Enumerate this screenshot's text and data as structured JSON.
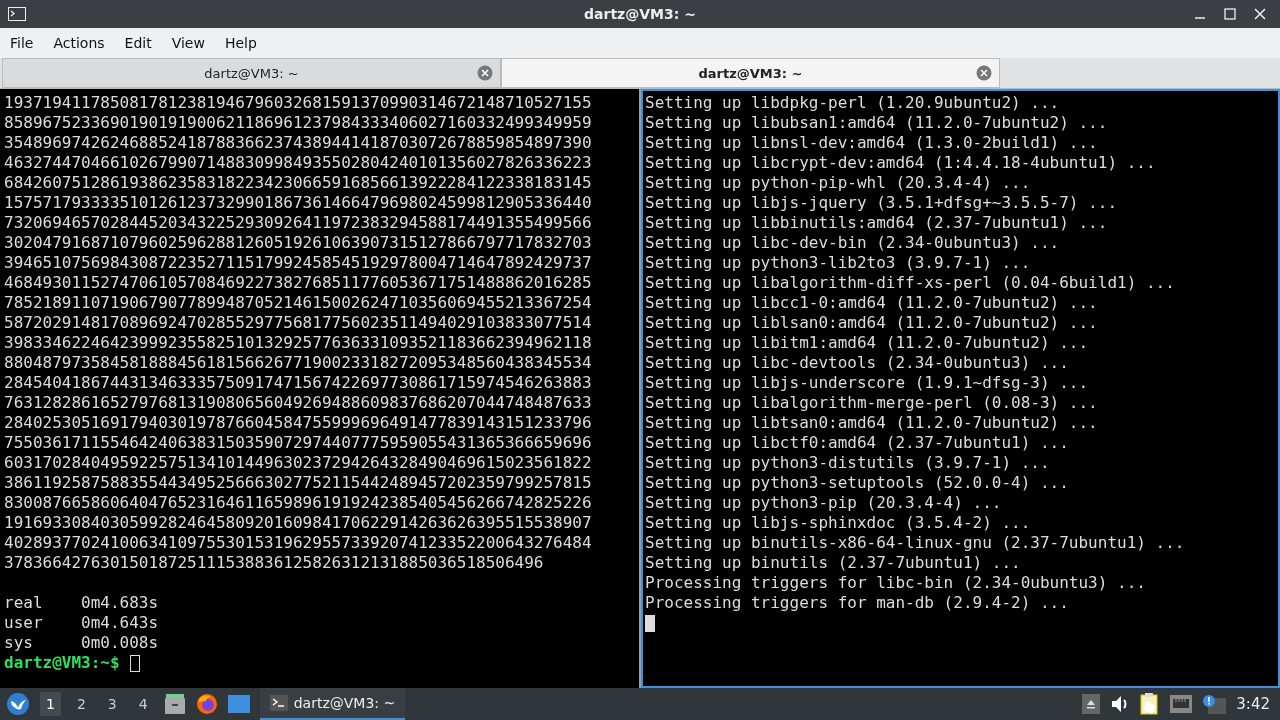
{
  "window": {
    "title": "dartz@VM3: ~"
  },
  "menu": [
    "File",
    "Actions",
    "Edit",
    "View",
    "Help"
  ],
  "tabs": [
    {
      "label": "dartz@VM3: ~",
      "selected": false
    },
    {
      "label": "dartz@VM3: ~",
      "selected": true
    }
  ],
  "panes": [
    {
      "focused": false,
      "lines": [
        {
          "kind": "output",
          "text": "1937194117850817812381946796032681591370990314672148710527155"
        },
        {
          "kind": "output",
          "text": "8589675233690190191900621186961237984333406027160332499349959"
        },
        {
          "kind": "output",
          "text": "3548969742624688524187883662374389441418703072678859854897390"
        },
        {
          "kind": "output",
          "text": "4632744704661026799071488309984935502804240101356027826336223"
        },
        {
          "kind": "output",
          "text": "6842607512861938623583182234230665916856613922284122338183145"
        },
        {
          "kind": "output",
          "text": "1575717933335101261237329901867361466479698024599812905336440"
        },
        {
          "kind": "output",
          "text": "7320694657028445203432252930926411972383294588174491355499566"
        },
        {
          "kind": "output",
          "text": "3020479168710796025962881260519261063907315127866797717832703"
        },
        {
          "kind": "output",
          "text": "3946510756984308722352711517992458545192978004714647892429737"
        },
        {
          "kind": "output",
          "text": "4684930115274706105708469227382768511776053671751488862016285"
        },
        {
          "kind": "output",
          "text": "7852189110719067907789948705214615002624710356069455213367254"
        },
        {
          "kind": "output",
          "text": "5872029148170896924702855297756817756023511494029103833077514"
        },
        {
          "kind": "output",
          "text": "3983346224642399923558251013292577636331093521183662394962118"
        },
        {
          "kind": "output",
          "text": "8804879735845818884561815662677190023318272095348560438345534"
        },
        {
          "kind": "output",
          "text": "2845404186744313463335750917471567422697730861715974546263883"
        },
        {
          "kind": "output",
          "text": "7631282861652797681319080656049269488609837686207044748487633"
        },
        {
          "kind": "output",
          "text": "2840253051691794030197876604584755999696491477839143151233796"
        },
        {
          "kind": "output",
          "text": "7550361711554642406383150359072974407775959055431365366659696"
        },
        {
          "kind": "output",
          "text": "6031702840495922575134101449630237294264328490469615023561822"
        },
        {
          "kind": "output",
          "text": "3861192587588355443495256663027752115442489457202359799257815"
        },
        {
          "kind": "output",
          "text": "8300876658606404765231646116598961919242385405456266742825226"
        },
        {
          "kind": "output",
          "text": "1916933084030599282464580920160984170622914263626395515538907"
        },
        {
          "kind": "output",
          "text": "4028937702410063410975530153196295573392074123352200643276484"
        },
        {
          "kind": "output",
          "text": "37836642763015018725111538836125826312131885036518506496"
        },
        {
          "kind": "blank"
        },
        {
          "kind": "output",
          "text": "real\t0m4.683s"
        },
        {
          "kind": "output",
          "text": "user\t0m4.643s"
        },
        {
          "kind": "output",
          "text": "sys\t0m0.008s"
        },
        {
          "kind": "prompt",
          "text": "dartz@VM3:~$"
        }
      ]
    },
    {
      "focused": true,
      "lines": [
        {
          "kind": "output",
          "text": "Setting up libdpkg-perl (1.20.9ubuntu2) ..."
        },
        {
          "kind": "output",
          "text": "Setting up libubsan1:amd64 (11.2.0-7ubuntu2) ..."
        },
        {
          "kind": "output",
          "text": "Setting up libnsl-dev:amd64 (1.3.0-2build1) ..."
        },
        {
          "kind": "output",
          "text": "Setting up libcrypt-dev:amd64 (1:4.4.18-4ubuntu1) ..."
        },
        {
          "kind": "output",
          "text": "Setting up python-pip-whl (20.3.4-4) ..."
        },
        {
          "kind": "output",
          "text": "Setting up libjs-jquery (3.5.1+dfsg+~3.5.5-7) ..."
        },
        {
          "kind": "output",
          "text": "Setting up libbinutils:amd64 (2.37-7ubuntu1) ..."
        },
        {
          "kind": "output",
          "text": "Setting up libc-dev-bin (2.34-0ubuntu3) ..."
        },
        {
          "kind": "output",
          "text": "Setting up python3-lib2to3 (3.9.7-1) ..."
        },
        {
          "kind": "output",
          "text": "Setting up libalgorithm-diff-xs-perl (0.04-6build1) ..."
        },
        {
          "kind": "output",
          "text": "Setting up libcc1-0:amd64 (11.2.0-7ubuntu2) ..."
        },
        {
          "kind": "output",
          "text": "Setting up liblsan0:amd64 (11.2.0-7ubuntu2) ..."
        },
        {
          "kind": "output",
          "text": "Setting up libitm1:amd64 (11.2.0-7ubuntu2) ..."
        },
        {
          "kind": "output",
          "text": "Setting up libc-devtools (2.34-0ubuntu3) ..."
        },
        {
          "kind": "output",
          "text": "Setting up libjs-underscore (1.9.1~dfsg-3) ..."
        },
        {
          "kind": "output",
          "text": "Setting up libalgorithm-merge-perl (0.08-3) ..."
        },
        {
          "kind": "output",
          "text": "Setting up libtsan0:amd64 (11.2.0-7ubuntu2) ..."
        },
        {
          "kind": "output",
          "text": "Setting up libctf0:amd64 (2.37-7ubuntu1) ..."
        },
        {
          "kind": "output",
          "text": "Setting up python3-distutils (3.9.7-1) ..."
        },
        {
          "kind": "output",
          "text": "Setting up python3-setuptools (52.0.0-4) ..."
        },
        {
          "kind": "output",
          "text": "Setting up python3-pip (20.3.4-4) ..."
        },
        {
          "kind": "output",
          "text": "Setting up libjs-sphinxdoc (3.5.4-2) ..."
        },
        {
          "kind": "output",
          "text": "Setting up binutils-x86-64-linux-gnu (2.37-7ubuntu1) ..."
        },
        {
          "kind": "output",
          "text": "Setting up binutils (2.37-7ubuntu1) ..."
        },
        {
          "kind": "output",
          "text": "Processing triggers for libc-bin (2.34-0ubuntu3) ..."
        },
        {
          "kind": "output",
          "text": "Processing triggers for man-db (2.9.4-2) ..."
        },
        {
          "kind": "cursor"
        }
      ]
    }
  ],
  "taskbar": {
    "workspaces": [
      {
        "label": "1",
        "selected": true
      },
      {
        "label": "2",
        "selected": false
      },
      {
        "label": "3",
        "selected": false
      },
      {
        "label": "4",
        "selected": false
      }
    ],
    "tasks": [
      {
        "label": "dartz@VM3: ~",
        "selected": true
      }
    ],
    "clock": "3:42"
  }
}
